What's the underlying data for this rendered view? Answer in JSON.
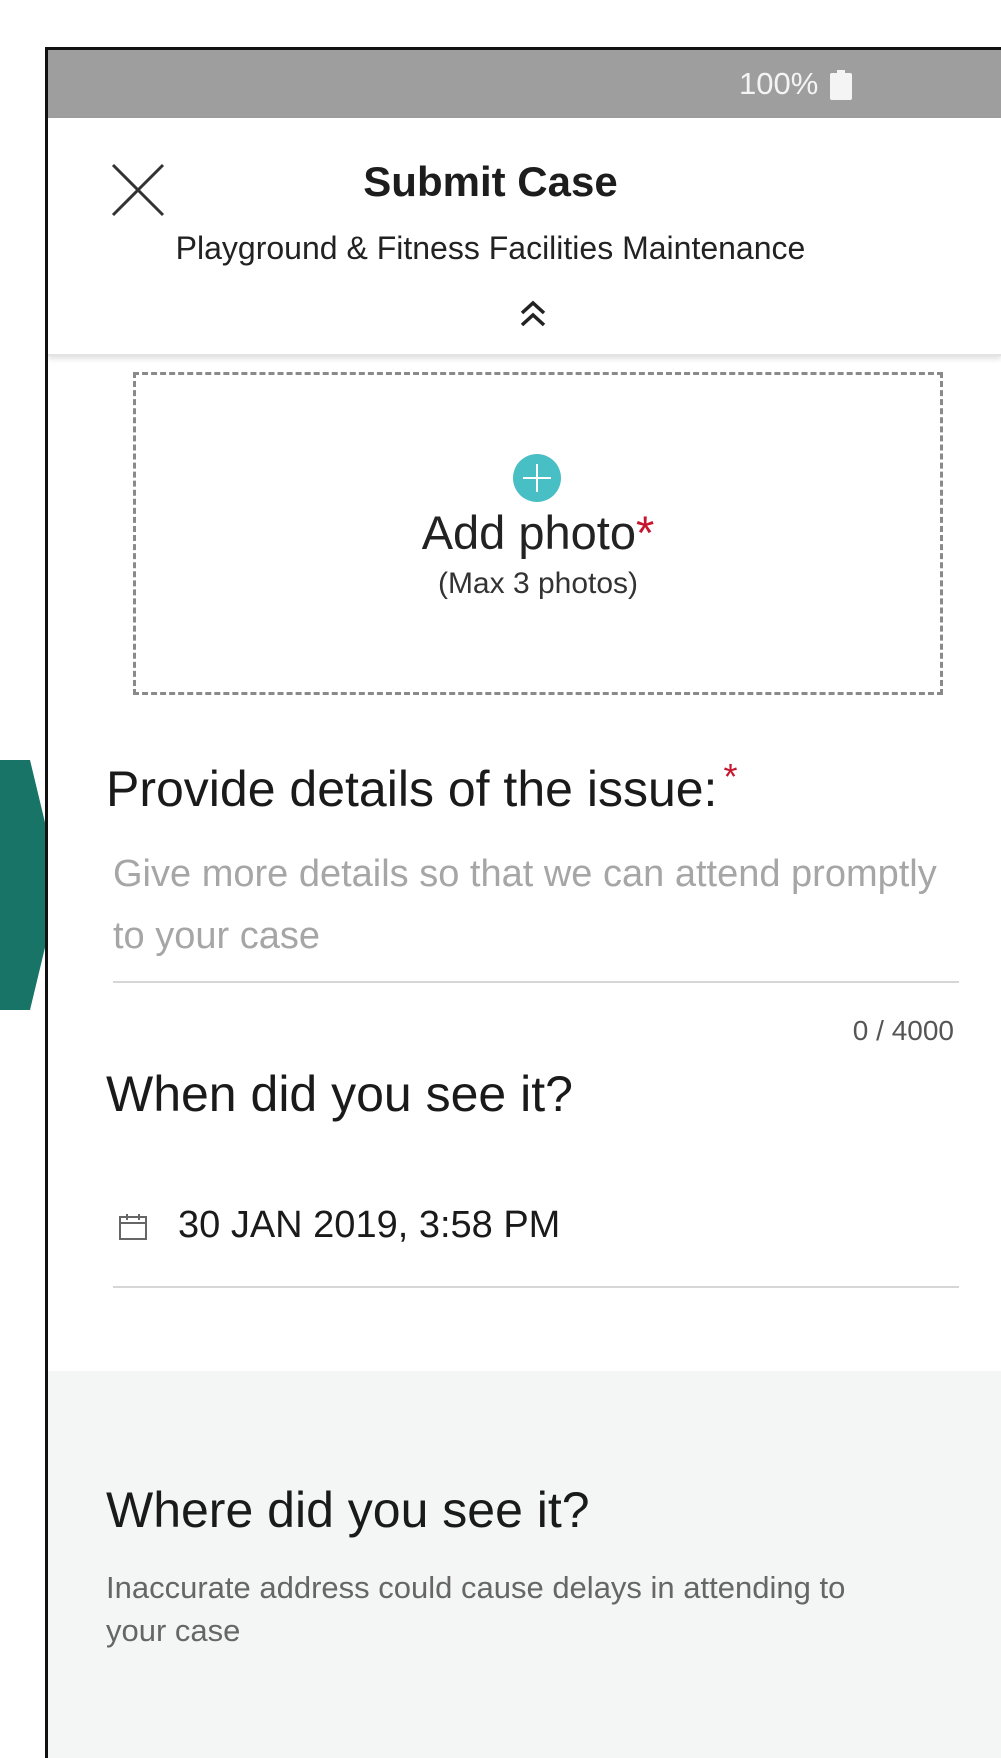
{
  "status_bar": {
    "battery": "100%"
  },
  "header": {
    "title": "Submit Case",
    "subtitle": "Playground & Fitness Facilities Maintenance"
  },
  "photo": {
    "label": "Add photo",
    "required_mark": "*",
    "hint": "(Max 3 photos)"
  },
  "details": {
    "label": "Provide details of the issue:",
    "required_mark": "*",
    "value": "",
    "placeholder": "Give more details so that we can attend promptly to your case",
    "counter": "0 / 4000"
  },
  "when": {
    "label": "When did you see it?",
    "datetime": "30 JAN 2019, 3:58 PM"
  },
  "where": {
    "label": "Where did you see it?",
    "hint": "Inaccurate address could cause delays in attending to your case"
  },
  "colors": {
    "status_bar": "#9e9e9e",
    "accent_teal": "#48bec5",
    "frame_green": "#177466",
    "required_red": "#c5162e"
  }
}
